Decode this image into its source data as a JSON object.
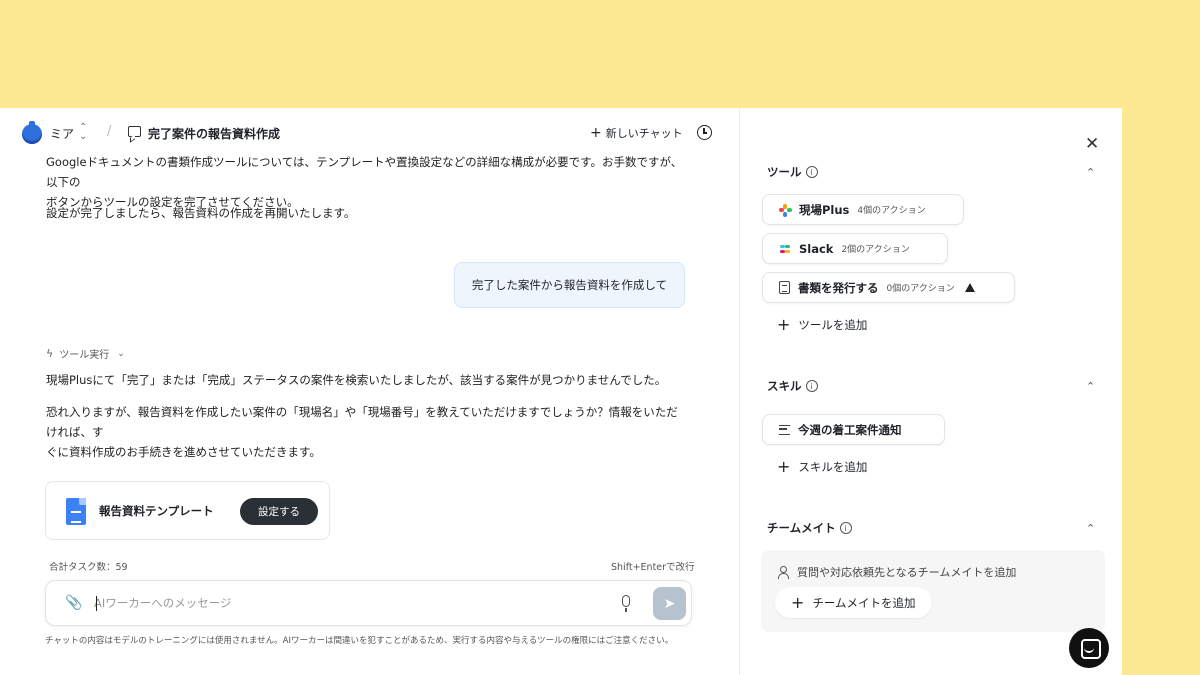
{
  "header": {
    "agent_name": "ミア",
    "separator": "/",
    "chat_title": "完了案件の報告資料作成",
    "new_chat_label": "新しいチャット"
  },
  "messages": {
    "assistant_1_line1": "Googleドキュメントの書類作成ツールについては、テンプレートや置換設定などの詳細な構成が必要です。お手数ですが、以下の",
    "assistant_1_line2": "ボタンからツールの設定を完了させてください。",
    "assistant_2": "設定が完了しましたら、報告資料の作成を再開いたします。",
    "user_1": "完了した案件から報告資料を作成して",
    "tool_run_label": "ツール実行",
    "assistant_3": "現場Plusにて「完了」または「完成」ステータスの案件を検索いたしましたが、該当する案件が見つかりませんでした。",
    "assistant_4_line1": "恐れ入りますが、報告資料を作成したい案件の「現場名」や「現場番号」を教えていただけますでしょうか？情報をいただければ、す",
    "assistant_4_line2": "ぐに資料作成のお手続きを進めさせていただきます。"
  },
  "template_card": {
    "name": "報告資料テンプレート",
    "button_label": "設定する"
  },
  "composer": {
    "task_count": "合計タスク数：59",
    "shortcut_hint": "Shift+Enterで改行",
    "placeholder": "AIワーカーへのメッセージ",
    "disclaimer": "チャットの内容はモデルのトレーニングには使用されません。AIワーカーは間違いを犯すことがあるため、実行する内容や与えるツールの権限にはご注意ください。"
  },
  "panel": {
    "tools_title": "ツール",
    "tools": [
      {
        "name": "現場Plus",
        "actions": "4個のアクション"
      },
      {
        "name": "Slack",
        "actions": "2個のアクション"
      },
      {
        "name": "書類を発行する",
        "actions": "0個のアクション"
      }
    ],
    "add_tool": "ツールを追加",
    "skills_title": "スキル",
    "skills": [
      {
        "name": "今週の着工案件通知"
      }
    ],
    "add_skill": "スキルを追加",
    "team_title": "チームメイト",
    "team_hint": "質問や対応依頼先となるチームメイトを追加",
    "add_team": "チームメイトを追加"
  },
  "icons": {
    "close": "✕",
    "chevron_up": "⌃",
    "chevron_down": "⌄",
    "info": "i",
    "clip": "📎",
    "send": "➤",
    "bolt": "ϟ",
    "plus": "+"
  },
  "colors": {
    "page_background": "#fde993",
    "primary_button": "#2b2f36",
    "user_bubble": "#eef5fd",
    "agent_avatar": "#2f6fdb"
  }
}
